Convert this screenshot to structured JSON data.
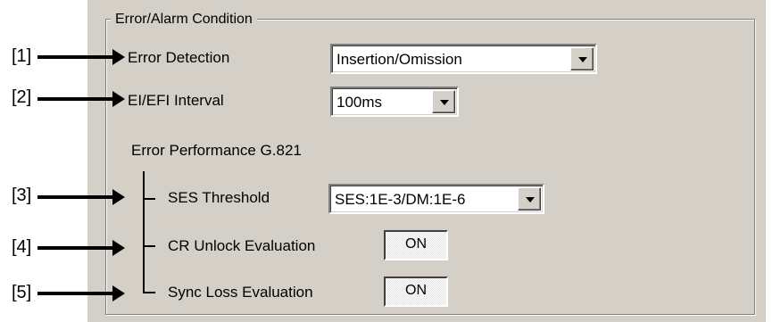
{
  "group": {
    "title": "Error/Alarm Condition"
  },
  "callouts": [
    "[1]",
    "[2]",
    "[3]",
    "[4]",
    "[5]"
  ],
  "error_detection": {
    "label": "Error Detection",
    "value": "Insertion/Omission"
  },
  "ei_efi_interval": {
    "label": "EI/EFI Interval",
    "value": "100ms"
  },
  "error_performance": {
    "heading": "Error Performance G.821"
  },
  "ses_threshold": {
    "label": "SES Threshold",
    "value": "SES:1E-3/DM:1E-6"
  },
  "cr_unlock": {
    "label": "CR Unlock Evaluation",
    "value": "ON"
  },
  "sync_loss": {
    "label": "Sync Loss Evaluation",
    "value": "ON"
  }
}
